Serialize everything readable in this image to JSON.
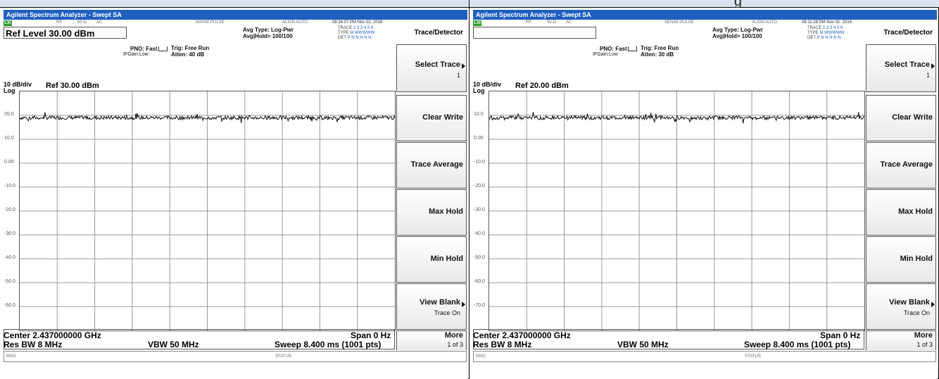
{
  "page": {
    "top_text": "g"
  },
  "panels": [
    {
      "title": "Agilent Spectrum Analyzer - Swept SA",
      "status": {
        "lxi": "LXI",
        "rf": "RF",
        "ohm": "50 Ω",
        "ac": "AC",
        "sense": "SENSE:PULSE",
        "align": "ALIGN AUTO",
        "timestamp": "08:24:07 PM Nov 02, 2016"
      },
      "ref_level": "Ref Level 30.00 dBm",
      "pno": "PNO: Fast",
      "ifgain": "IFGain:Low",
      "trig": "Trig: Free Run",
      "atten": "Atten: 40 dB",
      "avg_type": "Avg Type: Log-Pwr",
      "avg_hold": "Avg|Hold> 100/100",
      "trace_label": "TRACE",
      "trace_nums": "1 2 3 4 5 6",
      "type_label": "TYPE",
      "type_val": "M WWWWW",
      "det_label": "DET",
      "det_val": "P N N N N N",
      "scale_div": "10 dB/div",
      "scale_log": "Log",
      "ref_label": "Ref 30.00 dBm",
      "y_ticks": [
        "20.0",
        "10.0",
        "0.00",
        "-10.0",
        "-20.0",
        "-30.0",
        "-40.0",
        "-50.0",
        "-60.0"
      ],
      "center": "Center 2.437000000 GHz",
      "span": "Span 0 Hz",
      "res_bw": "Res BW 8 MHz",
      "vbw": "VBW 50 MHz",
      "sweep": "Sweep  8.400 ms (1001 pts)",
      "msg": "MSG",
      "status_label": "STATUS",
      "trace_level": 19.0
    },
    {
      "title": "Agilent Spectrum Analyzer - Swept SA",
      "status": {
        "lxi": "LXI",
        "rf": "RF",
        "ohm": "50 Ω",
        "ac": "AC",
        "sense": "SENSE:PULSE",
        "align": "ALIGN AUTO",
        "timestamp": "08:11:28 PM Nov 02, 2016"
      },
      "ref_level": "",
      "pno": "PNO: Fast",
      "ifgain": "IFGain:Low",
      "trig": "Trig: Free Run",
      "atten": "Atten: 30 dB",
      "avg_type": "Avg Type: Log-Pwr",
      "avg_hold": "Avg|Hold> 100/100",
      "trace_label": "TRACE",
      "trace_nums": "1 2 3 4 5 6",
      "type_label": "TYPE",
      "type_val": "M WWWWW",
      "det_label": "DET",
      "det_val": "P N N N N N",
      "scale_div": "10 dB/div",
      "scale_log": "Log",
      "ref_label": "Ref 20.00 dBm",
      "y_ticks": [
        "10.0",
        "0.00",
        "-10.0",
        "-20.0",
        "-30.0",
        "-40.0",
        "-50.0",
        "-60.0",
        "-70.0"
      ],
      "center": "Center 2.437000000 GHz",
      "span": "Span 0 Hz",
      "res_bw": "Res BW 8 MHz",
      "vbw": "VBW 50 MHz",
      "sweep": "Sweep  8.400 ms (1001 pts)",
      "msg": "MSG",
      "status_label": "STATUS",
      "trace_level": 9.0
    }
  ],
  "softkeys": {
    "header": "Trace/Detector",
    "select_trace": "Select Trace",
    "select_trace_value": "1",
    "clear_write": "Clear Write",
    "trace_average": "Trace Average",
    "max_hold": "Max Hold",
    "min_hold": "Min Hold",
    "view_blank": "View Blank",
    "view_blank_value": "Trace On",
    "more": "More",
    "more_value": "1 of 3"
  }
}
